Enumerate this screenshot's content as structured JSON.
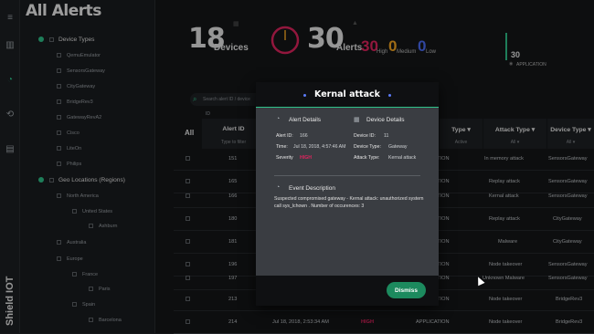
{
  "sidebar": {
    "title": "All Alerts",
    "brand": "Shield IOT",
    "groups": [
      {
        "label": "Device Types"
      },
      {
        "label": "Geo Locations (Regions)"
      }
    ],
    "device_types": [
      "QemuEmulator",
      "SensorsGateway",
      "CityGateway",
      "BridgeRev3",
      "GatewayRevA2",
      "Cisco",
      "LiteOn",
      "Philips"
    ],
    "geo": {
      "north_america": "North America",
      "united_states": "United States",
      "ashburn": "Ashburn",
      "australia": "Australia",
      "europe": "Europe",
      "france": "France",
      "paris": "Paris",
      "spain": "Spain",
      "barcelona": "Barcelona"
    }
  },
  "stats": {
    "devices_count": "18",
    "devices_label": "Devices",
    "alerts_count": "30",
    "alerts_label": "Alerts",
    "high_count": "30",
    "high_label": "High",
    "medium_count": "0",
    "medium_label": "Medium",
    "low_count": "0",
    "low_label": "Low",
    "application_count": "30",
    "application_label": "APPLICATION"
  },
  "search": {
    "placeholder": "Search alert ID / device"
  },
  "table": {
    "all_label": "All",
    "id_label": "ID",
    "headers": {
      "alert_id": "Alert ID",
      "alert_id_filter": "Type to filter",
      "type": "Type",
      "type_filter": "Active",
      "attack_type": "Attack Type",
      "attack_type_filter": "All",
      "device_type": "Device Type",
      "device_type_filter": "All"
    },
    "rows": [
      {
        "id": "151",
        "time": "",
        "severity": "",
        "type": "APPLICATION",
        "attack": "In memory attack",
        "device": "SensorsGateway"
      },
      {
        "id": "165",
        "time": "",
        "severity": "",
        "type": "APPLICATION",
        "attack": "Replay attack",
        "device": "SensorsGateway"
      },
      {
        "id": "166",
        "time": "",
        "severity": "",
        "type": "APPLICATION",
        "attack": "Kernal attack",
        "device": "SensorsGateway"
      },
      {
        "id": "180",
        "time": "",
        "severity": "",
        "type": "APPLICATION",
        "attack": "Replay attack",
        "device": "CityGateway"
      },
      {
        "id": "181",
        "time": "",
        "severity": "",
        "type": "APPLICATION",
        "attack": "Malware",
        "device": "CityGateway"
      },
      {
        "id": "196",
        "time": "",
        "severity": "",
        "type": "APPLICATION",
        "attack": "Node takeover",
        "device": "SensorsGateway"
      },
      {
        "id": "197",
        "time": "",
        "severity": "",
        "type": "APPLICATION",
        "attack": "Unknown Malware",
        "device": "SensorsGateway"
      },
      {
        "id": "213",
        "time": "",
        "severity": "",
        "type": "APPLICATION",
        "attack": "Node takeover",
        "device": "BridgeRev3"
      },
      {
        "id": "214",
        "time": "Jul 18, 2018, 2:53:34 AM",
        "severity": "HIGH",
        "type": "APPLICATION",
        "attack": "Node takeover",
        "device": "BridgeRev3"
      }
    ]
  },
  "modal": {
    "title": "Kernal attack",
    "alert_details_title": "Alert Details",
    "device_details_title": "Device Details",
    "alert_id_key": "Alert ID:",
    "alert_id_val": "166",
    "time_key": "Time:",
    "time_val": "Jul 18, 2018, 4:57:46 AM",
    "severity_key": "Severity",
    "severity_val": "HIGH",
    "device_id_key": "Device ID:",
    "device_id_val": "11",
    "device_type_key": "Device Type:",
    "device_type_val": "Gateway",
    "attack_type_key": "Attack Type:",
    "attack_type_val": "Kernal attack",
    "event_title": "Event Description",
    "event_text": "Suspected compromised gateway - Kernal attack: unauthorized system call sys_lchown . Number of occurences: 3",
    "dismiss_label": "Dismiss"
  },
  "colors": {
    "accent": "#2fc28a",
    "high": "#e0245e",
    "medium": "#f4a622",
    "low": "#4b6cf5"
  }
}
